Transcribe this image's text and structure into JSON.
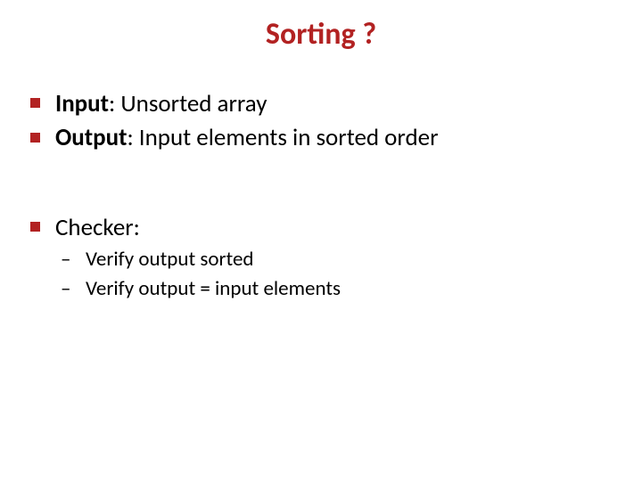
{
  "title": "Sorting ?",
  "bullets": {
    "input": {
      "label": "Input",
      "text": ": Unsorted array"
    },
    "output": {
      "label": "Output",
      "text": ": Input elements in sorted order"
    },
    "checker": {
      "label": "Checker:",
      "text": ""
    }
  },
  "sub": {
    "verify_sorted": "Verify output sorted",
    "verify_equal": "Verify output = input elements"
  },
  "colors": {
    "accent": "#b22222",
    "text": "#000000",
    "background": "#ffffff"
  }
}
